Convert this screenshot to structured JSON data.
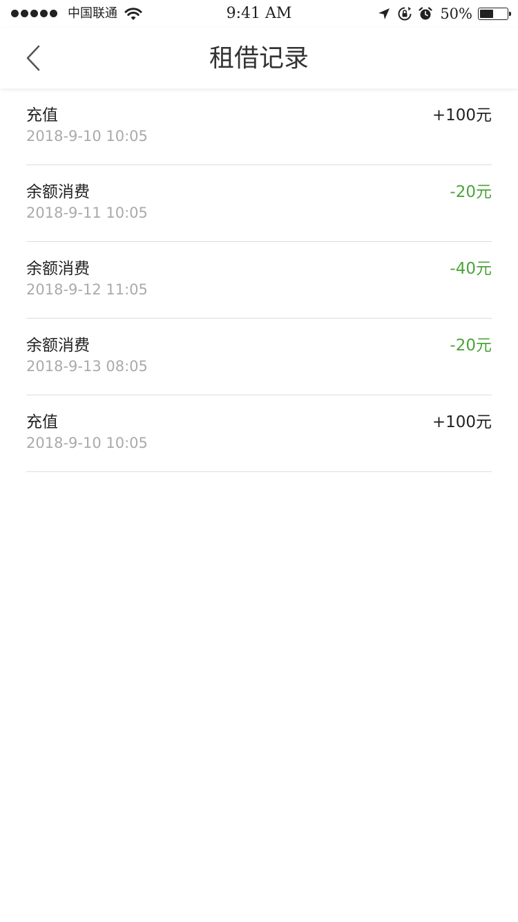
{
  "status_bar": {
    "carrier": "中国联通",
    "time": "9:41 AM",
    "battery_percent": "50%",
    "battery_level": 0.5,
    "icons": [
      "signal-dots",
      "wifi-icon",
      "location-arrow-icon",
      "rotation-lock-icon",
      "alarm-icon",
      "battery-icon"
    ]
  },
  "nav": {
    "title": "租借记录",
    "back_icon": "chevron-left-icon"
  },
  "colors": {
    "negative_amount": "#4aa33a",
    "positive_amount": "#222222",
    "timestamp": "#aaaaaa",
    "divider": "#dddddd"
  },
  "records": [
    {
      "title": "充值",
      "time": "2018-9-10 10:05",
      "amount": "+100元",
      "type": "positive"
    },
    {
      "title": "余额消费",
      "time": "2018-9-11 10:05",
      "amount": "-20元",
      "type": "negative"
    },
    {
      "title": "余额消费",
      "time": "2018-9-12 11:05",
      "amount": "-40元",
      "type": "negative"
    },
    {
      "title": "余额消费",
      "time": "2018-9-13 08:05",
      "amount": "-20元",
      "type": "negative"
    },
    {
      "title": "充值",
      "time": "2018-9-10 10:05",
      "amount": "+100元",
      "type": "positive"
    }
  ]
}
